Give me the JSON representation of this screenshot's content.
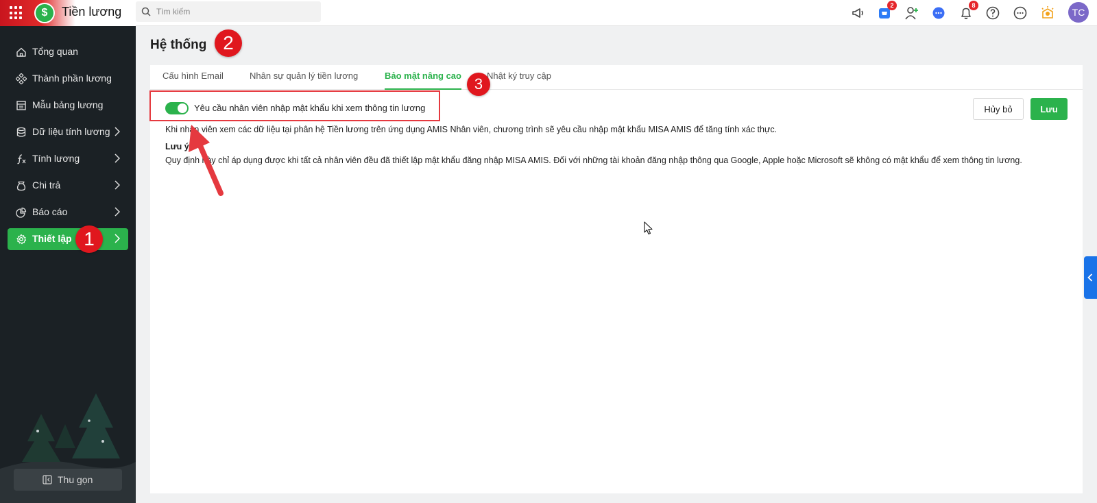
{
  "app": {
    "title": "Tiền lương",
    "logo_glyph": "$",
    "search_placeholder": "Tìm kiếm",
    "avatar_initials": "TC",
    "badges": {
      "cart": "2",
      "notifications": "8"
    },
    "colors": {
      "accent": "#2bb24c",
      "sidebar_bg": "#1b2125",
      "badge": "#e5262b",
      "annotation": "#e0171e"
    }
  },
  "sidebar": {
    "items": [
      {
        "label": "Tổng quan",
        "icon": "home-icon",
        "has_submenu": false
      },
      {
        "label": "Thành phần lương",
        "icon": "components-icon",
        "has_submenu": false
      },
      {
        "label": "Mẫu bảng lương",
        "icon": "template-icon",
        "has_submenu": false
      },
      {
        "label": "Dữ liệu tính lương",
        "icon": "database-icon",
        "has_submenu": true
      },
      {
        "label": "Tính lương",
        "icon": "function-icon",
        "has_submenu": true
      },
      {
        "label": "Chi trả",
        "icon": "money-bag-icon",
        "has_submenu": true
      },
      {
        "label": "Báo cáo",
        "icon": "pie-chart-icon",
        "has_submenu": true
      },
      {
        "label": "Thiết lập",
        "icon": "gear-icon",
        "has_submenu": true,
        "active": true
      }
    ],
    "collapse_label": "Thu gọn"
  },
  "main": {
    "page_title": "Hệ thống",
    "tabs": [
      {
        "label": "Cấu hình Email",
        "active": false
      },
      {
        "label": "Nhân sự quản lý tiền lương",
        "active": false
      },
      {
        "label": "Bảo mật nâng cao",
        "active": true
      },
      {
        "label": "Nhật ký truy cập",
        "active": false
      }
    ],
    "toggle": {
      "label": "Yêu cầu nhân viên nhập mật khẩu khi xem thông tin lương",
      "enabled": true
    },
    "description": "Khi nhân viên xem các dữ liệu tại phân hệ Tiền lương trên ứng dụng AMIS Nhân viên, chương trình sẽ yêu cầu nhập mật khẩu MISA AMIS để tăng tính xác thực.",
    "note_title": "Lưu ý:",
    "note_text": "Quy định này chỉ áp dụng được khi tất cả nhân viên đều đã thiết lập mật khẩu đăng nhập MISA AMIS. Đối với những tài khoản đăng nhập thông qua Google, Apple hoặc Microsoft sẽ không có mật khẩu để xem thông tin lương.",
    "cancel_label": "Hủy bỏ",
    "save_label": "Lưu"
  },
  "annotations": {
    "step1": "1",
    "step2": "2",
    "step3": "3"
  }
}
